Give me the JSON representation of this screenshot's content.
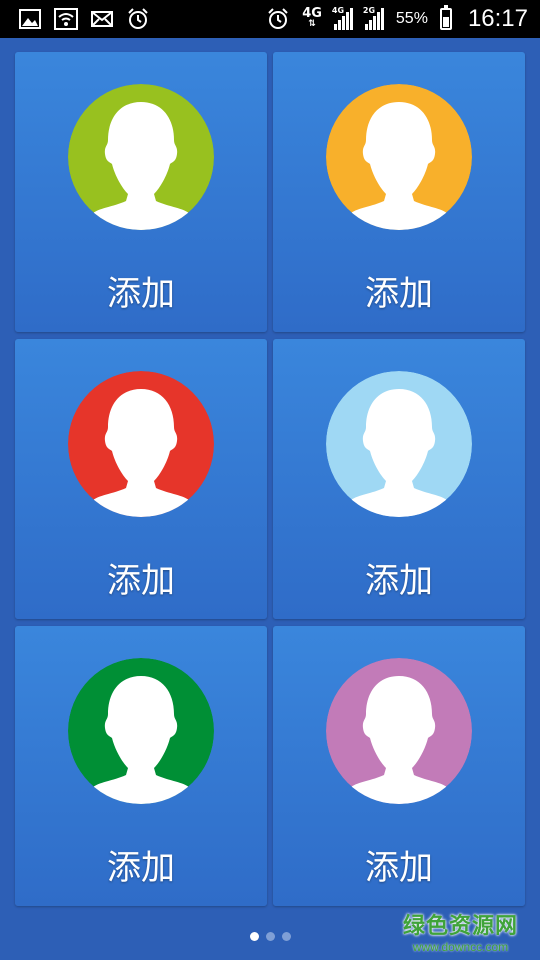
{
  "status_bar": {
    "left_icons": [
      "gallery-icon",
      "wifi-icon",
      "mail-icon",
      "alarm-icon"
    ],
    "alarm_icon": "alarm-icon",
    "network": "4G",
    "signal_tag_1": "4G",
    "signal_tag_2": "2G",
    "battery_percent": "55%",
    "time": "16:17"
  },
  "contacts": [
    {
      "label": "添加",
      "color": "#98c11f"
    },
    {
      "label": "添加",
      "color": "#f8b02b"
    },
    {
      "label": "添加",
      "color": "#e6352a"
    },
    {
      "label": "添加",
      "color": "#9fd8f4"
    },
    {
      "label": "添加",
      "color": "#008f35"
    },
    {
      "label": "添加",
      "color": "#c27bb8"
    }
  ],
  "pager": {
    "pages": 3,
    "active": 0
  },
  "watermark": {
    "main": "绿色资源网",
    "sub": "www.downcc.com"
  }
}
